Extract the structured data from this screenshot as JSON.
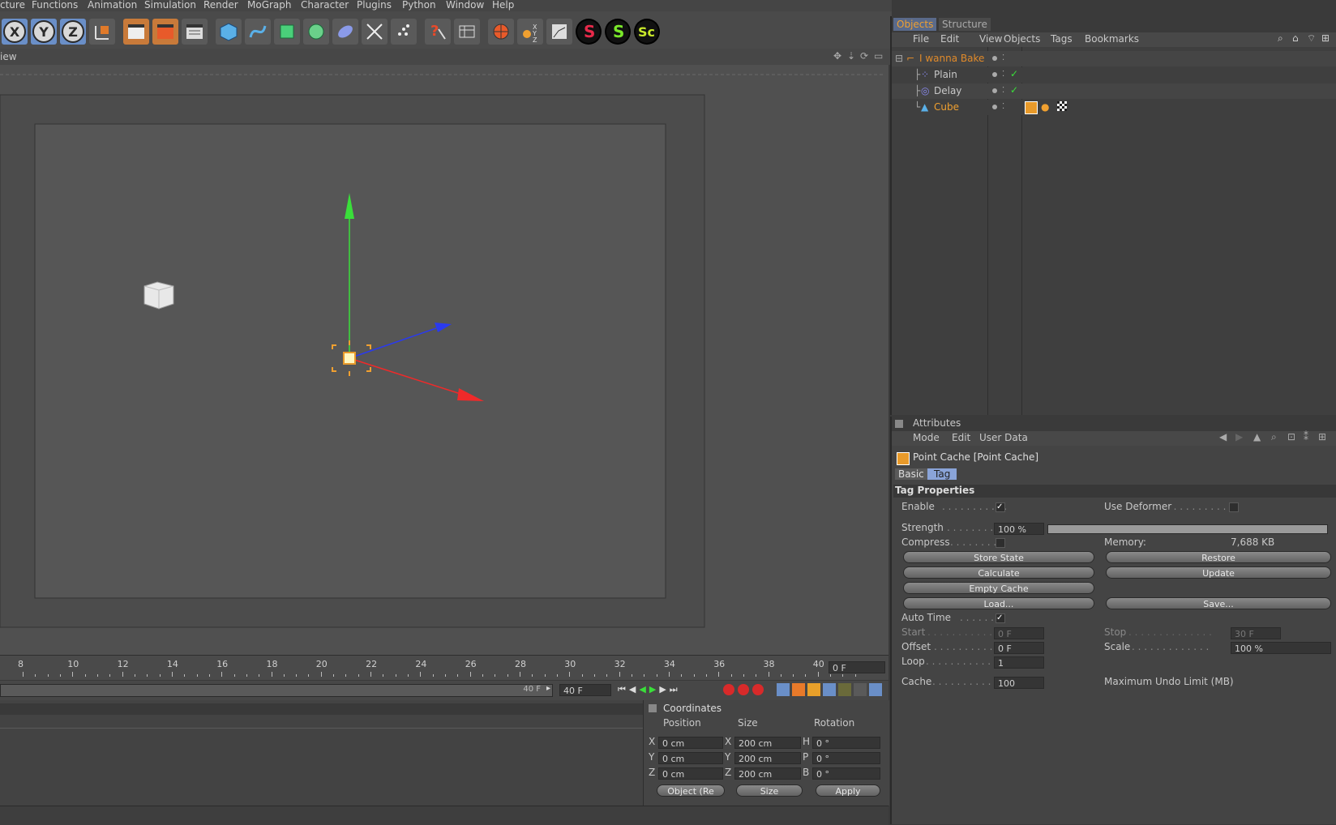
{
  "menu": [
    "cture",
    "Functions",
    "Animation",
    "Simulation",
    "Render",
    "MoGraph",
    "Character",
    "Plugins",
    "Python",
    "Window",
    "Help"
  ],
  "viewport": {
    "label": "iew"
  },
  "timeline": {
    "ticks": [
      "8",
      "10",
      "12",
      "14",
      "16",
      "18",
      "20",
      "22",
      "24",
      "26",
      "28",
      "30",
      "32",
      "34",
      "36",
      "38",
      "40"
    ],
    "current_frame": "0 F",
    "end_frame_field": "40 F",
    "end_frame_slider": "40 F"
  },
  "coordinates": {
    "title": "Coordinates",
    "headers": [
      "Position",
      "Size",
      "Rotation"
    ],
    "rows": [
      {
        "pos_axis": "X",
        "pos": "0 cm",
        "size_axis": "X",
        "size": "200 cm",
        "rot_axis": "H",
        "rot": "0 °"
      },
      {
        "pos_axis": "Y",
        "pos": "0 cm",
        "size_axis": "Y",
        "size": "200 cm",
        "rot_axis": "P",
        "rot": "0 °"
      },
      {
        "pos_axis": "Z",
        "pos": "0 cm",
        "size_axis": "Z",
        "size": "200 cm",
        "rot_axis": "B",
        "rot": "0 °"
      }
    ],
    "mode_select": "Object (Re",
    "size_select": "Size",
    "apply": "Apply"
  },
  "objects": {
    "tabs": [
      "Objects",
      "Structure"
    ],
    "menu": [
      "File",
      "Edit",
      "View",
      "Objects",
      "Tags",
      "Bookmarks"
    ],
    "items": [
      {
        "name": "I wanna Bake",
        "color": "#e08a2a"
      },
      {
        "name": "Plain",
        "color": "#d0d0d0"
      },
      {
        "name": "Delay",
        "color": "#d0d0d0"
      },
      {
        "name": "Cube",
        "color": "#f0a030"
      }
    ]
  },
  "attributes": {
    "title": "Attributes",
    "menu": [
      "Mode",
      "Edit",
      "User Data"
    ],
    "object_title": "Point Cache [Point Cache]",
    "tabs": [
      "Basic",
      "Tag"
    ],
    "section": "Tag Properties",
    "enable": "Enable",
    "use_deformer": "Use Deformer",
    "strength": "Strength",
    "strength_value": "100 %",
    "compress": "Compress",
    "memory_label": "Memory:",
    "memory_value": "7,688 KB",
    "buttons": {
      "store_state": "Store State",
      "restore": "Restore",
      "calculate": "Calculate",
      "update": "Update",
      "empty_cache": "Empty Cache",
      "load": "Load...",
      "save": "Save..."
    },
    "auto_time": "Auto Time",
    "start": "Start",
    "start_value": "0 F",
    "stop": "Stop",
    "stop_value": "30 F",
    "offset": "Offset",
    "offset_value": "0 F",
    "scale": "Scale",
    "scale_value": "100 %",
    "loop": "Loop",
    "loop_value": "1",
    "cache": "Cache",
    "cache_value": "100",
    "max_undo": "Maximum Undo Limit (MB)"
  }
}
